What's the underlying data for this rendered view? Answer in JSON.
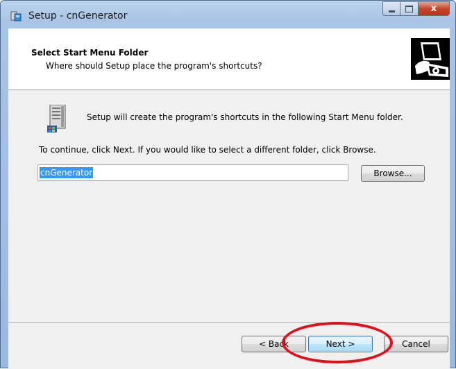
{
  "window": {
    "title": "Setup - cnGenerator",
    "close_glyph": "x"
  },
  "header": {
    "title": "Select Start Menu Folder",
    "subtitle": "Where should Setup place the program's shortcuts?"
  },
  "body": {
    "info": "Setup will create the program's shortcuts in the following Start Menu folder.",
    "instruction": "To continue, click Next. If you would like to select a different folder, click Browse.",
    "folder_value": "cnGenerator",
    "browse_label": "Browse..."
  },
  "footer": {
    "back_label": "< Back",
    "next_label": "Next >",
    "cancel_label": "Cancel"
  },
  "icons": {
    "app": "setup-app-icon",
    "logo": "setup-computer-logo-icon",
    "folder": "start-menu-folder-icon"
  },
  "colors": {
    "selection": "#3399ff",
    "highlight_annotation": "#e0101a",
    "close_button": "#c8452c"
  }
}
